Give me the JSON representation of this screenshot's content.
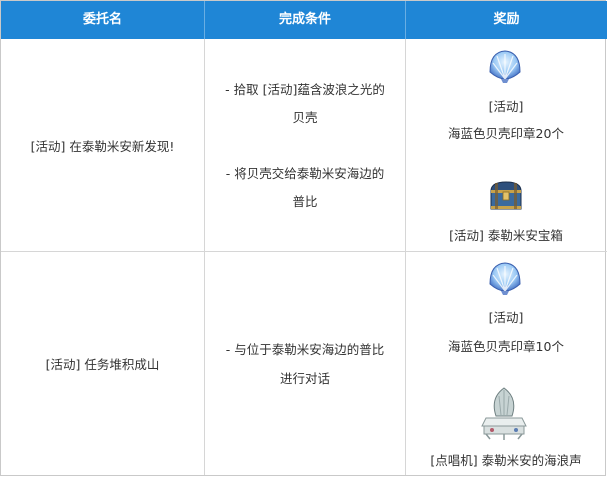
{
  "header": {
    "col1": "委托名",
    "col2": "完成条件",
    "col3": "奖励"
  },
  "rows": [
    {
      "name": "[活动] 在泰勒米安新发现!",
      "conditions": [
        "- 拾取 [活动]蕴含波浪之光的",
        "贝壳",
        "- 将贝壳交给泰勒米安海边的",
        "普比"
      ],
      "rewards": [
        {
          "icon": "sea-shell-icon",
          "line1": "[活动]",
          "line2": "海蓝色贝壳印章20个"
        },
        {
          "icon": "treasure-chest-icon",
          "line1": "[活动] 泰勒米安宝箱"
        }
      ]
    },
    {
      "name": "[活动] 任务堆积成山",
      "conditions": [
        "- 与位于泰勒米安海边的普比",
        "进行对话"
      ],
      "rewards": [
        {
          "icon": "sea-shell-icon",
          "line1": "[活动]",
          "line2": "海蓝色贝壳印章10个"
        },
        {
          "icon": "shell-jukebox-icon",
          "line1": "[点唱机] 泰勒米安的海浪声"
        }
      ]
    }
  ],
  "colors": {
    "header_bg": "#1f86d6",
    "header_text": "#ffffff",
    "border": "#d6d6d6"
  }
}
